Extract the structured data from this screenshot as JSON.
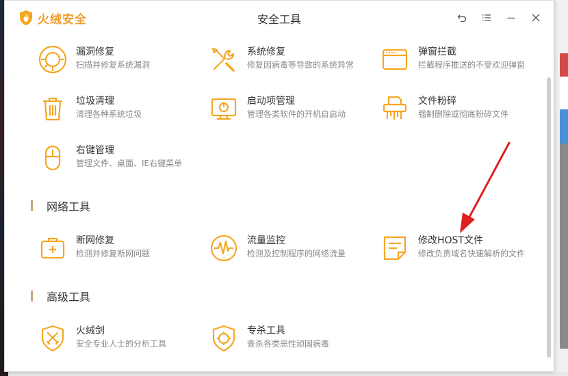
{
  "window": {
    "brand_name": "火绒安全",
    "title": "安全工具"
  },
  "title_buttons": {
    "back_icon": "back-arrow-icon",
    "menu_icon": "menu-icon",
    "minimize_icon": "minimize-icon",
    "close_icon": "close-icon"
  },
  "colors": {
    "accent": "#f5a623",
    "brand": "#f19b28",
    "section_bar": "#c4a57a",
    "annotation_arrow": "#e02020"
  },
  "system_tools": [
    {
      "icon": "vulnerability-repair-icon",
      "name": "漏洞修复",
      "desc": "扫描并修复系统漏洞"
    },
    {
      "icon": "system-repair-icon",
      "name": "系统修复",
      "desc": "修复因病毒等导致的系统异常"
    },
    {
      "icon": "popup-block-icon",
      "name": "弹窗拦截",
      "desc": "拦截程序推送的不受欢迎弹窗"
    },
    {
      "icon": "trash-icon",
      "name": "垃圾清理",
      "desc": "清理各种系统垃圾"
    },
    {
      "icon": "startup-manager-icon",
      "name": "启动项管理",
      "desc": "管理各类软件的开机自启动"
    },
    {
      "icon": "file-shredder-icon",
      "name": "文件粉碎",
      "desc": "强制删除或彻底粉碎文件"
    },
    {
      "icon": "mouse-icon",
      "name": "右键管理",
      "desc": "管理文件、桌面、IE右键菜单"
    }
  ],
  "network_section": {
    "label": "网络工具",
    "tools": [
      {
        "icon": "network-repair-icon",
        "name": "断网修复",
        "desc": "检测并修复断网问题"
      },
      {
        "icon": "traffic-monitor-icon",
        "name": "流量监控",
        "desc": "检测及控制程序的网络流量"
      },
      {
        "icon": "host-file-icon",
        "name": "修改HOST文件",
        "desc": "修改负责域名快速解析的文件"
      }
    ]
  },
  "advanced_section": {
    "label": "高级工具",
    "tools": [
      {
        "icon": "sword-shield-icon",
        "name": "火绒剑",
        "desc": "安全专业人士的分析工具"
      },
      {
        "icon": "antivirus-shield-icon",
        "name": "专杀工具",
        "desc": "查杀各类恶性顽固病毒"
      }
    ]
  }
}
